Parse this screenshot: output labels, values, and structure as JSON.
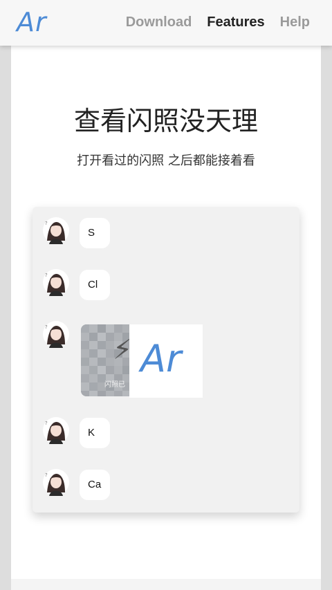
{
  "header": {
    "logo_text": "Ar",
    "nav": [
      {
        "label": "Download",
        "active": false
      },
      {
        "label": "Features",
        "active": true
      },
      {
        "label": "Help",
        "active": false
      }
    ]
  },
  "hero": {
    "title": "查看闪照没天理",
    "subtitle": "打开看过的闪照 之后都能接着看"
  },
  "chat": {
    "messages": [
      {
        "type": "text",
        "text": "S"
      },
      {
        "type": "text",
        "text": "Cl"
      },
      {
        "type": "image",
        "caption": "闪照已",
        "logo_text": "Ar"
      },
      {
        "type": "text",
        "text": "K"
      },
      {
        "type": "text",
        "text": "Ca"
      }
    ]
  },
  "colors": {
    "accent": "#4d8bd6",
    "nav_active": "#222222",
    "nav_inactive": "#9a9a9a"
  }
}
